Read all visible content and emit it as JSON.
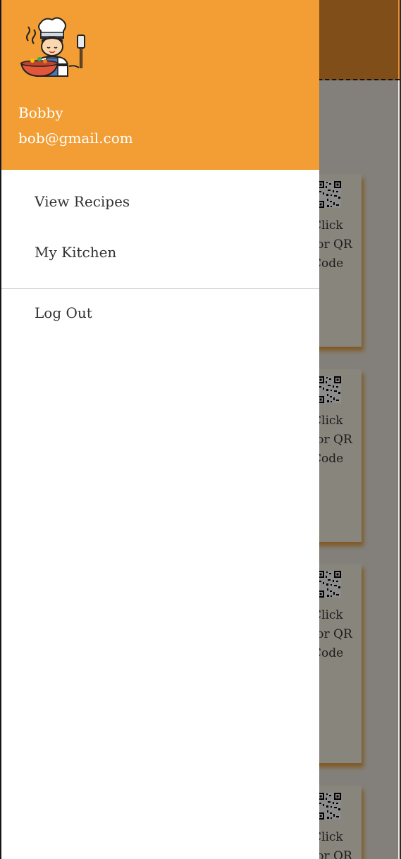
{
  "drawer": {
    "user_name": "Bobby",
    "user_email": "bob@gmail.com",
    "menu": {
      "view_recipes": "View Recipes",
      "my_kitchen": "My Kitchen",
      "log_out": "Log Out"
    },
    "avatar_icon": "chef-cooking-icon"
  },
  "background": {
    "qr_label": "Click for QR Code",
    "qr_icon": "qr-code-icon"
  },
  "colors": {
    "drawer_header": "#f29e35",
    "app_header": "#e9902f",
    "card_shadow": "#e69628",
    "drawer_bg": "#ffffff",
    "text": "#333333"
  }
}
